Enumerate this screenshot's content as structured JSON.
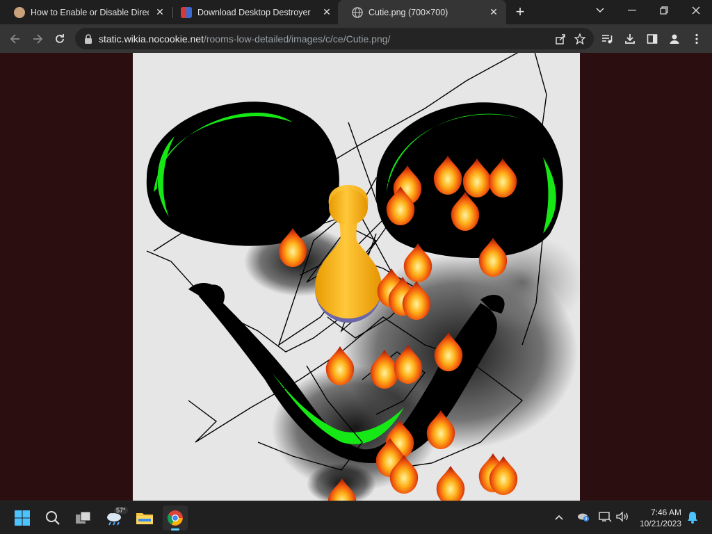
{
  "tabs": [
    {
      "title": "How to Enable or Disable Direct",
      "favicon": "site-favicon"
    },
    {
      "title": "Download Desktop Destroyer",
      "favicon": "site-favicon"
    },
    {
      "title": "Cutie.png (700×700)",
      "favicon": "globe-icon"
    }
  ],
  "address_bar": {
    "host": "static.wikia.nocookie.net",
    "path": "/rooms-low-detailed/images/c/ce/Cutie.png/"
  },
  "image": {
    "description_icon": "cutie-face-drawing"
  },
  "taskbar": {
    "weather_temp": "57°",
    "time": "7:46 AM",
    "date": "10/21/2023"
  },
  "colors": {
    "tabstrip": "#1f1f1f",
    "toolbar": "#353535",
    "viewer_bg": "#2b0f10",
    "image_bg": "#e6e6e6",
    "accent_green": "#16e816",
    "pawn_orange": "#f7b21b"
  }
}
